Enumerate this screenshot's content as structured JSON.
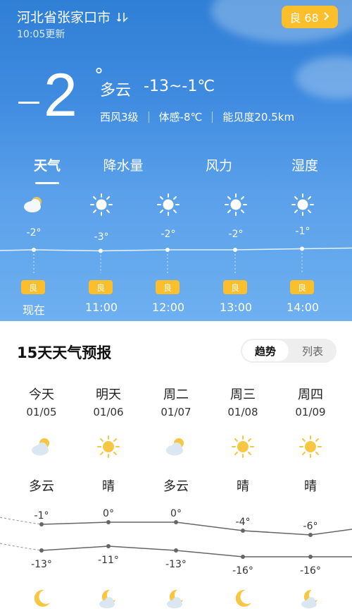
{
  "header": {
    "location": "河北省张家口市",
    "update_time": "10:05更新",
    "aqi_label": "良 68",
    "aqi_color": "#fcbf2c"
  },
  "current": {
    "temp_value": "2",
    "degree": "°",
    "condition": "多云",
    "range": "-13~-1℃",
    "wind": "西风3级",
    "feels_like": "体感-8℃",
    "visibility": "能见度20.5km"
  },
  "tabs": [
    "天气",
    "降水量",
    "风力",
    "湿度"
  ],
  "hourly": [
    {
      "time": "现在",
      "temp": "-2°",
      "temp_value": -2,
      "aqi": "良",
      "icon": "cloudy-icon"
    },
    {
      "time": "11:00",
      "temp": "-3°",
      "temp_value": -3,
      "aqi": "良",
      "icon": "sun-icon"
    },
    {
      "time": "12:00",
      "temp": "-2°",
      "temp_value": -2,
      "aqi": "良",
      "icon": "sun-icon"
    },
    {
      "time": "13:00",
      "temp": "-2°",
      "temp_value": -2,
      "aqi": "良",
      "icon": "sun-icon"
    },
    {
      "time": "14:00",
      "temp": "-1°",
      "temp_value": -1,
      "aqi": "良",
      "icon": "sun-icon"
    }
  ],
  "forecast": {
    "title": "15天天气预报",
    "view_trend": "趋势",
    "view_list": "列表",
    "days": [
      {
        "name": "今天",
        "date": "01/05",
        "day_icon": "partly-cloudy-icon",
        "cond": "多云",
        "high": "-1°",
        "high_value": -1,
        "low": "-13°",
        "low_value": -13,
        "night_icon": "moon-icon"
      },
      {
        "name": "明天",
        "date": "01/06",
        "day_icon": "sun-icon",
        "cond": "晴",
        "high": "0°",
        "high_value": 0,
        "low": "-11°",
        "low_value": -11,
        "night_icon": "cloudy-night-icon"
      },
      {
        "name": "周二",
        "date": "01/07",
        "day_icon": "partly-cloudy-icon",
        "cond": "多云",
        "high": "0°",
        "high_value": 0,
        "low": "-13°",
        "low_value": -13,
        "night_icon": "cloudy-night-icon"
      },
      {
        "name": "周三",
        "date": "01/08",
        "day_icon": "sun-icon",
        "cond": "晴",
        "high": "-4°",
        "high_value": -4,
        "low": "-16°",
        "low_value": -16,
        "night_icon": "moon-icon"
      },
      {
        "name": "周四",
        "date": "01/09",
        "day_icon": "sun-icon",
        "cond": "晴",
        "high": "-6°",
        "high_value": -6,
        "low": "-16°",
        "low_value": -16,
        "night_icon": "cloudy-night-icon"
      }
    ]
  }
}
